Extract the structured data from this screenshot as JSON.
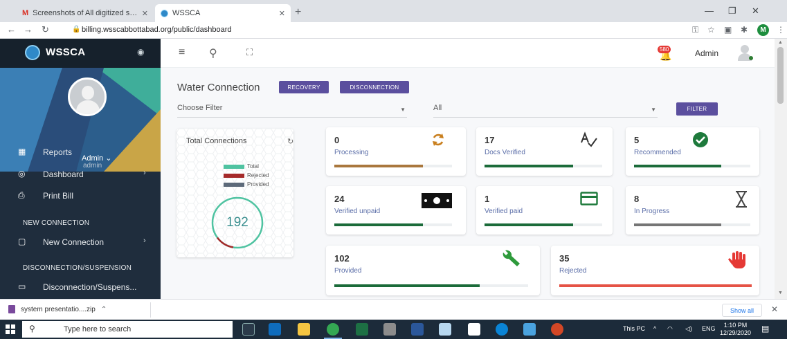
{
  "browser": {
    "tabs": [
      {
        "title": "Screenshots of All digitized syste",
        "active": false
      },
      {
        "title": "WSSCA",
        "active": true
      }
    ],
    "url": "billing.wsscabbottabad.org/public/dashboard",
    "profile_initial": "M"
  },
  "sidebar": {
    "brand": "WSSCA",
    "user_name": "Admin",
    "user_role": "admin",
    "items": [
      {
        "label": "Reports",
        "icon": "calculator-icon",
        "has_chevron": false
      },
      {
        "label": "Dashboard",
        "icon": "palette-icon",
        "has_chevron": true
      },
      {
        "label": "Print Bill",
        "icon": "printer-icon",
        "has_chevron": false
      }
    ],
    "section_new_connection": "NEW CONNECTION",
    "new_connection_item": {
      "label": "New Connection",
      "icon": "clipboard-icon"
    },
    "section_disconnection": "DISCONNECTION/SUSPENSION",
    "disconnection_item": {
      "label": "Disconnection/Suspens...",
      "icon": "keyboard-icon"
    }
  },
  "topbar": {
    "notification_count": "580",
    "admin_label": "Admin"
  },
  "main": {
    "title": "Water Connection",
    "recovery_button": "RECOVERY",
    "disconnection_button": "DISCONNECTION",
    "filter_placeholder": "Choose Filter",
    "filter_value": "All",
    "filter_button": "FILTER"
  },
  "total_connections": {
    "title": "Total Connections",
    "total": "192",
    "legend": [
      {
        "label": "Total",
        "color": "#4fc3a1"
      },
      {
        "label": "Rejected",
        "color": "#a52a2a"
      },
      {
        "label": "Provided",
        "color": "#5d6a7a"
      }
    ]
  },
  "stats": [
    {
      "value": "0",
      "label": "Processing",
      "icon": "refresh-icon",
      "bar_color": "#a9773d",
      "progress": 0.75
    },
    {
      "value": "17",
      "label": "Docs Verified",
      "icon": "spellcheck-icon",
      "bar_color": "#1b6b3a",
      "progress": 0.75
    },
    {
      "value": "5",
      "label": "Recommended",
      "icon": "check-circle-icon",
      "bar_color": "#1b6b3a",
      "progress": 0.75
    },
    {
      "value": "24",
      "label": "Verified unpaid",
      "icon": "cash-icon",
      "bar_color": "#1b6b3a",
      "progress": 0.75
    },
    {
      "value": "1",
      "label": "Verified paid",
      "icon": "credit-card-icon",
      "bar_color": "#1b6b3a",
      "progress": 0.75
    },
    {
      "value": "8",
      "label": "In Progress",
      "icon": "hourglass-icon",
      "bar_color": "#757575",
      "progress": 0.75
    },
    {
      "value": "102",
      "label": "Provided",
      "icon": "wrench-icon",
      "bar_color": "#1b6b3a",
      "progress": 0.75
    },
    {
      "value": "35",
      "label": "Rejected",
      "icon": "hand-stop-icon",
      "bar_color": "#e55346",
      "progress": 1.0
    }
  ],
  "download": {
    "file": "system presentatio....zip",
    "show_all": "Show all"
  },
  "taskbar": {
    "search_placeholder": "Type here to search",
    "tray_label": "This PC",
    "lang": "ENG",
    "time": "1:10 PM",
    "date": "12/29/2020"
  }
}
